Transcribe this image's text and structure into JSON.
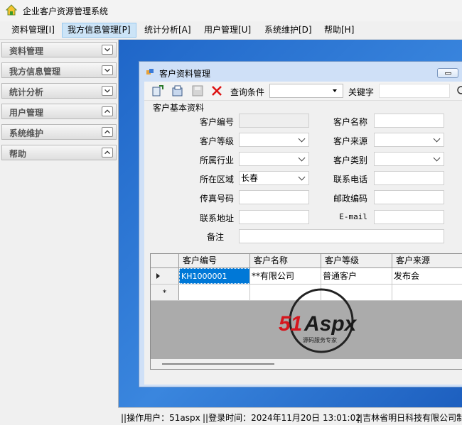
{
  "app": {
    "title": "企业客户资源管理系统"
  },
  "menu": [
    {
      "label": "资料管理[I]",
      "active": false
    },
    {
      "label": "我方信息管理[P]",
      "active": true
    },
    {
      "label": "统计分析[A]",
      "active": false
    },
    {
      "label": "用户管理[U]",
      "active": false
    },
    {
      "label": "系统维护[D]",
      "active": false
    },
    {
      "label": "帮助[H]",
      "active": false
    }
  ],
  "sidebar": [
    {
      "label": "资料管理",
      "icon": "chevron-down-icon"
    },
    {
      "label": "我方信息管理",
      "icon": "chevron-down-icon"
    },
    {
      "label": "统计分析",
      "icon": "chevron-down-icon"
    },
    {
      "label": "用户管理",
      "icon": "chevron-up-icon"
    },
    {
      "label": "系统维护",
      "icon": "chevron-up-icon"
    },
    {
      "label": "帮助",
      "icon": "chevron-up-icon"
    }
  ],
  "window": {
    "title": "客户资料管理",
    "toolbar": {
      "query_label": "查询条件",
      "query_value": "",
      "keyword_label": "关键字",
      "keyword_value": ""
    },
    "group_label": "客户基本资料",
    "form": {
      "customer_id": {
        "label": "客户编号",
        "value": ""
      },
      "customer_name": {
        "label": "客户名称",
        "value": ""
      },
      "customer_level": {
        "label": "客户等级",
        "value": ""
      },
      "customer_source": {
        "label": "客户来源",
        "value": ""
      },
      "industry": {
        "label": "所属行业",
        "value": ""
      },
      "customer_type": {
        "label": "客户类别",
        "value": ""
      },
      "region": {
        "label": "所在区域",
        "value": "长春"
      },
      "phone": {
        "label": "联系电话",
        "value": ""
      },
      "fax": {
        "label": "传真号码",
        "value": ""
      },
      "postcode": {
        "label": "邮政编码",
        "value": ""
      },
      "address": {
        "label": "联系地址",
        "value": ""
      },
      "email": {
        "label": "E-mail",
        "value": ""
      },
      "remark": {
        "label": "备注",
        "value": ""
      }
    },
    "grid": {
      "columns": [
        "客户编号",
        "客户名称",
        "客户等级",
        "客户来源"
      ],
      "rows": [
        [
          "KH1000001",
          "**有限公司",
          "普通客户",
          "发布会"
        ]
      ],
      "new_row_marker": "*"
    }
  },
  "watermark": {
    "text": "51Aspx",
    "sub": "源码服务专家"
  },
  "status": {
    "operator": "||操作用户：51aspx",
    "login_time": "||登录时间：2024年11月20日 13:01:02",
    "company": "||吉林省明日科技有限公司制"
  },
  "colors": {
    "accent": "#0078d7",
    "desktop": "#2a74d4",
    "menu_active": "#cce4f7"
  }
}
